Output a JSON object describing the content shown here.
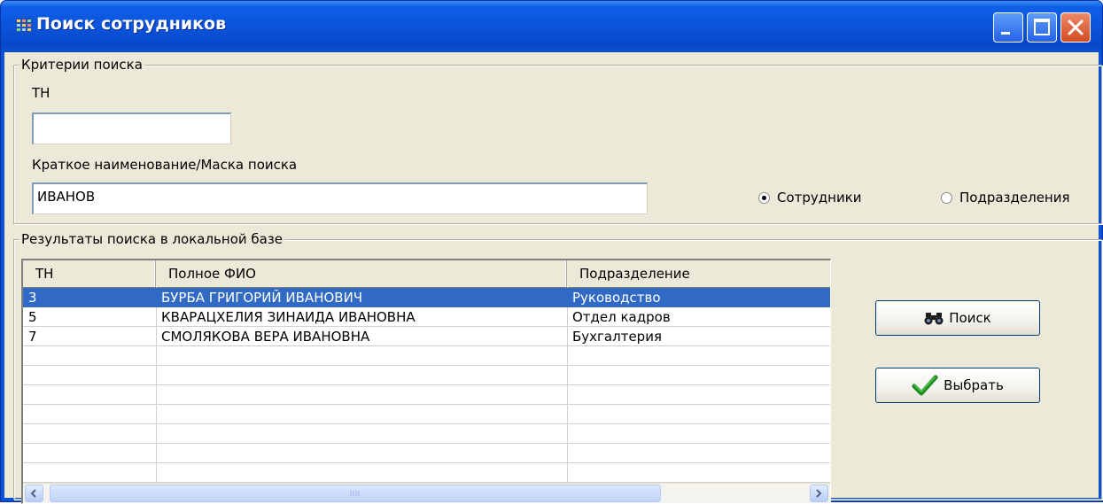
{
  "window": {
    "title": "Поиск сотрудников"
  },
  "criteria": {
    "legend": "Критерии поиска",
    "tn_label": "ТН",
    "tn_value": "",
    "mask_label": "Краткое наименование/Маска поиска",
    "mask_value": "ИВАНОВ",
    "radio_employees": "Сотрудники",
    "radio_departments": "Подразделения",
    "selected_radio": "employees"
  },
  "results": {
    "legend": "Результаты поиска в локальной базе",
    "columns": [
      "ТН",
      "Полное ФИО",
      "Подразделение"
    ],
    "rows": [
      {
        "tn": "3",
        "fio": "БУРБА ГРИГОРИЙ ИВАНОВИЧ",
        "dept": "Руководство",
        "selected": true
      },
      {
        "tn": "5",
        "fio": "КВАРАЦХЕЛИЯ ЗИНАИДА ИВАНОВНА",
        "dept": "Отдел кадров",
        "selected": false
      },
      {
        "tn": "7",
        "fio": "СМОЛЯКОВА ВЕРА ИВАНОВНА",
        "dept": "Бухгалтерия",
        "selected": false
      }
    ]
  },
  "buttons": {
    "search_label": "Поиск",
    "select_label": "Выбрать"
  },
  "colors": {
    "selection": "#316ac5",
    "titlebar": "#0a52d9"
  }
}
